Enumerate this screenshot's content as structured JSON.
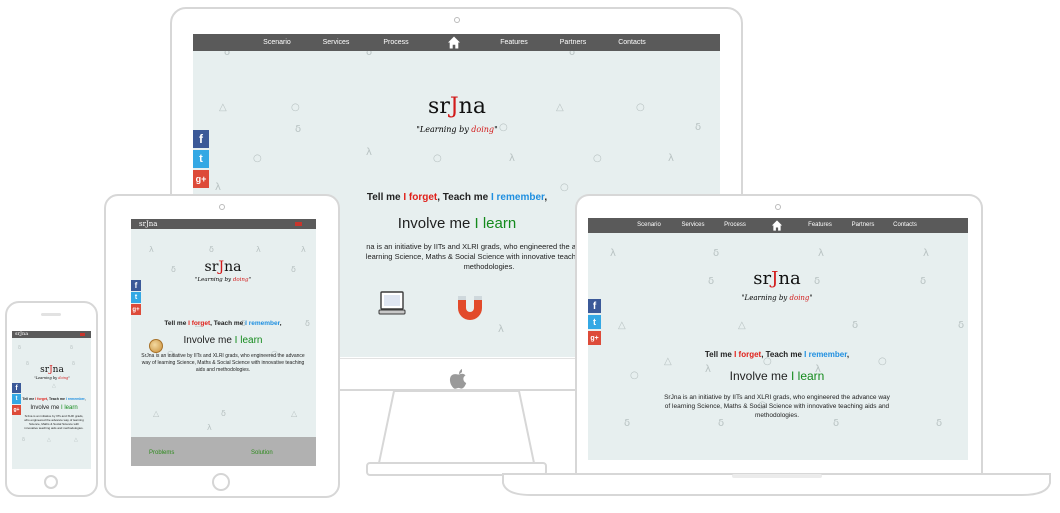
{
  "brand": {
    "logo_prefix": "sr",
    "logo_j": "J",
    "logo_suffix": "na",
    "tagline_open": "\"Learning by ",
    "tagline_doing": "doing",
    "tagline_close": "\""
  },
  "nav": {
    "scenario": "Scenario",
    "services": "Services",
    "process": "Process",
    "features": "Features",
    "partners": "Partners",
    "contacts": "Contacts",
    "home_icon": "home-icon"
  },
  "social": {
    "facebook": "f",
    "twitter": "t",
    "google": "g+"
  },
  "quote": {
    "tell": "Tell me ",
    "forget": "I forget",
    "teach": ", Teach me ",
    "remember": "I remember",
    "end": ","
  },
  "involve": {
    "prefix": "Involve me ",
    "learn": "I learn"
  },
  "description": {
    "full": "SrJna is an initiative by IITs and XLRI grads, who engineered the advance way of learning Science, Maths & Social Science with innovative teaching aids and methodologies.",
    "desktop_clipped": "na is an initiative by IITs and XLRI grads, who engineered the advance wa learning Science, Maths & Social Science with innovative teaching aids an methodologies."
  },
  "tablet_footer": {
    "problems": "Problems",
    "solution": "Solution"
  },
  "pattern_glyphs": {
    "triangle": "△",
    "circle": "○",
    "lambda": "λ",
    "delta": "δ"
  },
  "colors": {
    "nav_bg": "#5a5a5a",
    "screen_bg": "#e7efef",
    "facebook": "#3b5998",
    "twitter": "#34a8e4",
    "google": "#dd4b39",
    "red": "#e0201a",
    "blue": "#1f8fe0",
    "green": "#148a1c"
  }
}
